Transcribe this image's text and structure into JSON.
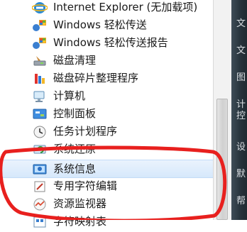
{
  "menu": {
    "items": [
      {
        "label": "Internet Explorer (无加载项)",
        "icon": "internet-explorer-icon"
      },
      {
        "label": "Windows 轻松传送",
        "icon": "easy-transfer-icon"
      },
      {
        "label": "Windows 轻松传送报告",
        "icon": "easy-transfer-reports-icon"
      },
      {
        "label": "磁盘清理",
        "icon": "disk-cleanup-icon"
      },
      {
        "label": "磁盘碎片整理程序",
        "icon": "disk-defragmenter-icon"
      },
      {
        "label": "计算机",
        "icon": "computer-icon"
      },
      {
        "label": "控制面板",
        "icon": "control-panel-icon"
      },
      {
        "label": "任务计划程序",
        "icon": "task-scheduler-icon"
      },
      {
        "label": "系统还原",
        "icon": "system-restore-icon"
      },
      {
        "label": "系统信息",
        "icon": "system-information-icon",
        "highlighted": true
      },
      {
        "label": "专用字符编辑",
        "icon": "private-character-editor-icon"
      },
      {
        "label": "资源监视器",
        "icon": "resource-monitor-icon"
      },
      {
        "label": "字符映射表",
        "icon": "character-map-icon"
      }
    ]
  },
  "right_pane": {
    "glyphs": [
      "文",
      "文",
      "图",
      "计",
      "控",
      "设",
      "默",
      "帮"
    ]
  },
  "annotation": {
    "color": "#e8201e",
    "shape": "ellipse"
  },
  "colors": {
    "highlight": "#d6e8fb",
    "right_pane_bg": "#26323b",
    "scrollbar_thumb": "#d0d0d0"
  }
}
